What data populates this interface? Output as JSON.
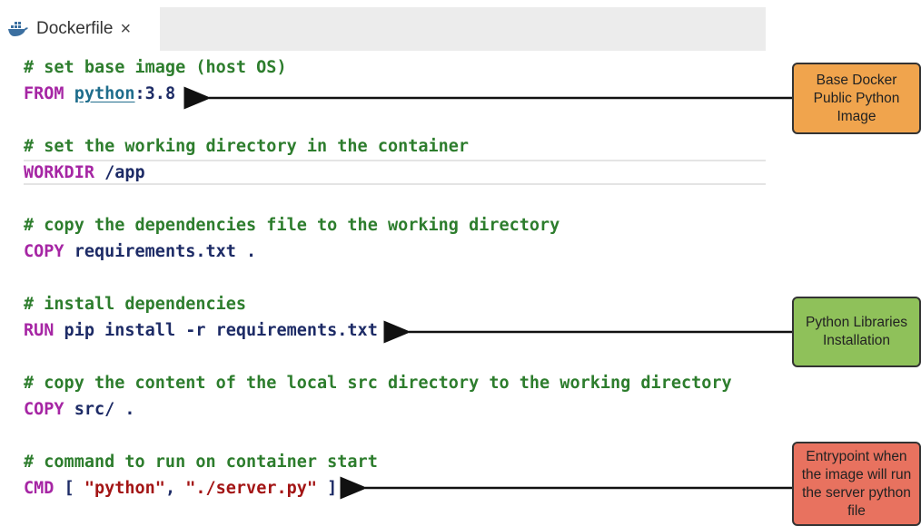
{
  "tab": {
    "icon": "docker-whale-icon",
    "label": "Dockerfile",
    "close": "×"
  },
  "code": {
    "line1": "# set base image (host OS)",
    "line2_kw": "FROM",
    "line2_image": "python",
    "line2_rest": ":3.8",
    "line3": "# set the working directory in the container",
    "line4_kw": "WORKDIR",
    "line4_rest": " /app",
    "line5": "# copy the dependencies file to the working directory",
    "line6_kw": "COPY",
    "line6_rest": " requirements.txt .",
    "line7": "# install dependencies",
    "line8_kw": "RUN",
    "line8_rest": " pip install -r requirements.txt",
    "line9": "# copy the content of the local src directory to the working directory",
    "line10_kw": "COPY",
    "line10_rest": " src/ .",
    "line11": "# command to run on container start",
    "line12_kw": "CMD",
    "line12_a": " [ ",
    "line12_s1": "\"python\"",
    "line12_b": ", ",
    "line12_s2": "\"./server.py\"",
    "line12_c": " ]"
  },
  "callouts": {
    "base": [
      "Base Docker",
      "Public Python",
      "Image"
    ],
    "libs": [
      "Python Libraries",
      "Installation"
    ],
    "entry": [
      "Entrypoint when",
      "the image will run",
      "the server python",
      "file"
    ]
  },
  "colors": {
    "comment": "#2d7d2d",
    "keyword": "#a626a4",
    "text": "#1d2b66",
    "orange": "#f0a44d",
    "green": "#8fc15a",
    "red": "#e8725f"
  }
}
